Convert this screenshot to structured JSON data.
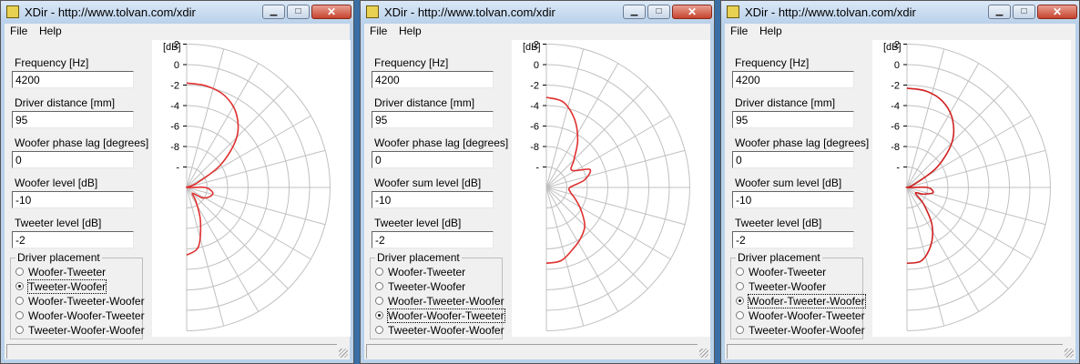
{
  "windows": [
    {
      "title": "XDir - http://www.tolvan.com/xdir",
      "menu": [
        "File",
        "Help"
      ],
      "fields": [
        {
          "label": "Frequency [Hz]",
          "value": "4200"
        },
        {
          "label": "Driver distance [mm]",
          "value": "95"
        },
        {
          "label": "Woofer phase lag [degrees]",
          "value": "0"
        },
        {
          "label": "Woofer level [dB]",
          "value": "-10"
        },
        {
          "label": "Tweeter level [dB]",
          "value": "-2"
        }
      ],
      "group_label": "Driver placement",
      "options": [
        "Woofer-Tweeter",
        "Tweeter-Woofer",
        "Woofer-Tweeter-Woofer",
        "Woofer-Woofer-Tweeter",
        "Tweeter-Woofer-Woofer"
      ],
      "selected": 1,
      "plot": {
        "unit_label": "[dB]",
        "radial_ticks": [
          "2",
          "0",
          "-2",
          "-4",
          "-6",
          "-8",
          "-"
        ],
        "curve_color": "#e03030",
        "response_db": [
          0.2,
          0.1,
          -0.3,
          -1.3,
          -3.1,
          -6.0,
          -9.0,
          -10.4,
          -8.2,
          -7.4,
          -7.6,
          -8.2,
          -9.2,
          -8.4,
          -6.5,
          -4.1,
          -3.4
        ]
      }
    },
    {
      "title": "XDir - http://www.tolvan.com/xdir",
      "menu": [
        "File",
        "Help"
      ],
      "fields": [
        {
          "label": "Frequency [Hz]",
          "value": "4200"
        },
        {
          "label": "Driver distance [mm]",
          "value": "95"
        },
        {
          "label": "Woofer phase lag [degrees]",
          "value": "0"
        },
        {
          "label": "Woofer sum level [dB]",
          "value": "-10"
        },
        {
          "label": "Tweeter level [dB]",
          "value": "-2"
        }
      ],
      "group_label": "Driver placement",
      "options": [
        "Woofer-Tweeter",
        "Tweeter-Woofer",
        "Woofer-Tweeter-Woofer",
        "Woofer-Woofer-Tweeter",
        "Tweeter-Woofer-Woofer"
      ],
      "selected": 3,
      "plot": {
        "unit_label": "[dB]",
        "radial_ticks": [
          "2",
          "0",
          "-2",
          "-4",
          "-6",
          "-8",
          "-"
        ],
        "curve_color": "#e03030",
        "response_db": [
          -1.2,
          -1.5,
          -2.8,
          -4.5,
          -6.2,
          -7.0,
          -5.4,
          -6.2,
          -7.7,
          -7.6,
          -6.9,
          -5.9,
          -4.7,
          -4.0,
          -3.4,
          -2.7,
          -2.6
        ]
      }
    },
    {
      "title": "XDir - http://www.tolvan.com/xdir",
      "menu": [
        "File",
        "Help"
      ],
      "fields": [
        {
          "label": "Frequency [Hz]",
          "value": "4200"
        },
        {
          "label": "Driver distance [mm]",
          "value": "95"
        },
        {
          "label": "Woofer phase lag [degrees]",
          "value": "0"
        },
        {
          "label": "Woofer sum level [dB]",
          "value": "-10"
        },
        {
          "label": "Tweeter level [dB]",
          "value": "-2"
        }
      ],
      "group_label": "Driver placement",
      "options": [
        "Woofer-Tweeter",
        "Tweeter-Woofer",
        "Woofer-Tweeter-Woofer",
        "Woofer-Woofer-Tweeter",
        "Tweeter-Woofer-Woofer"
      ],
      "selected": 2,
      "plot": {
        "unit_label": "[dB]",
        "radial_ticks": [
          "2",
          "0",
          "-2",
          "-4",
          "-6",
          "-8",
          "-"
        ],
        "curve_color": "#d02020",
        "response_db": [
          -0.3,
          -0.4,
          -0.9,
          -2.0,
          -3.8,
          -6.5,
          -9.3,
          -10.2,
          -8.0,
          -7.4,
          -8.3,
          -9.0,
          -7.7,
          -5.6,
          -3.9,
          -2.7,
          -2.6
        ]
      }
    }
  ]
}
